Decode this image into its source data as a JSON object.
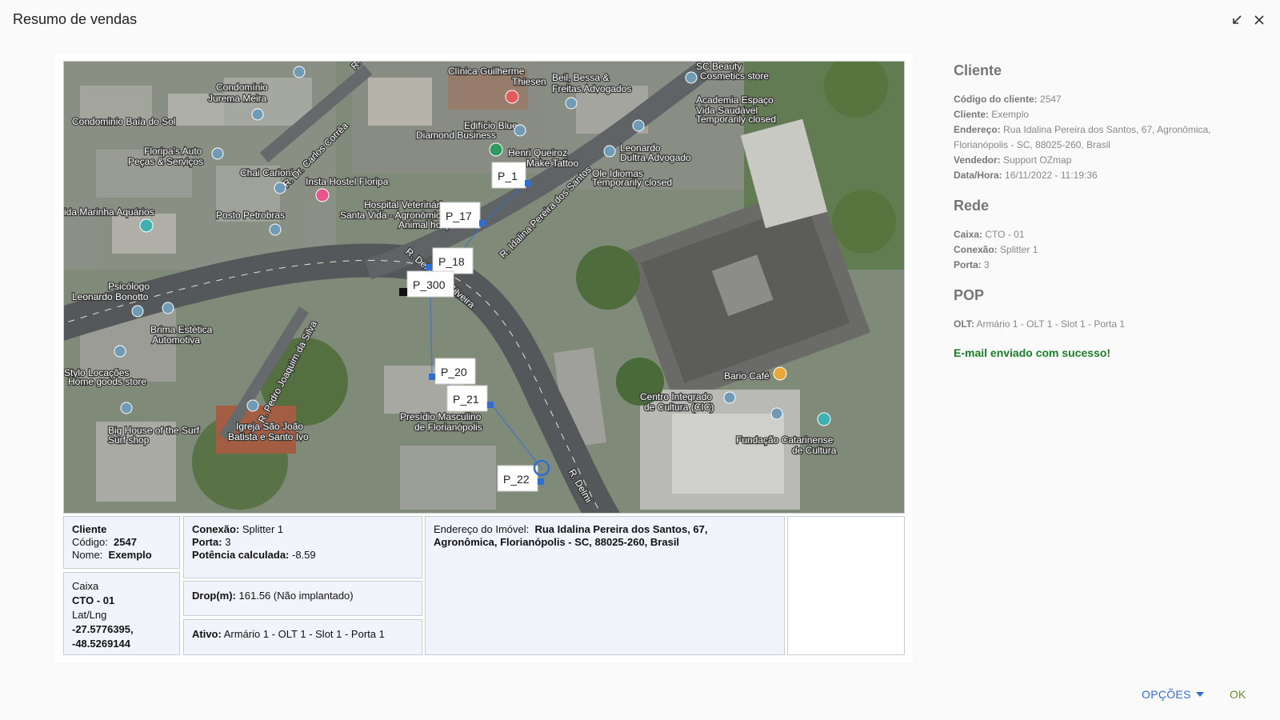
{
  "window": {
    "title": "Resumo de vendas"
  },
  "map": {
    "markers": [
      "P_1",
      "P_17",
      "P_18",
      "P_300",
      "P_20",
      "P_21",
      "P_22"
    ],
    "places": [
      "Condomínio Jurema Meira",
      "Condominio Baía do Sol",
      "Clínica Guilherme Thiesen",
      "Beil, Bessa & Freitas Advogados",
      "SC Beauty",
      "Cosmetics store",
      "Academia Espaço Vida Saudável",
      "Temporarily closed",
      "Edifício Blue Diamond Business",
      "Henri Queiroz Make Tattoo",
      "Leonardo Dultra Advogado",
      "Ole Idiomas",
      "Temporarily closed",
      "Floripa's Auto Peças & Serviços",
      "Chai Carioni",
      "Insta Hostel Floripa",
      "Hospital Veterinário Santa Vida - Agronômica",
      "Animal hosp",
      "ida Marinha Aquários",
      "Posto Petrobras",
      "Psicólogo Leonardo Bonotto",
      "Brima Estética Automotiva",
      "Stylo Locações",
      "Home goods store",
      "Big House of the Surf",
      "Surf shop",
      "Igreja São João Batista e Santo Ivo",
      "Presídio Masculino de Florianópolis",
      "Bario Café",
      "Centro Integrado de Cultura (CIC)",
      "Fundação Catarinense de Cultura"
    ],
    "streets": [
      "R. Dr. Carlos Corrêa",
      "R. Idalina Pereira dos Santos",
      "R. Delminda Silveira",
      "R. Pedro Joaquim da Silva",
      "R. Delmi",
      "R."
    ]
  },
  "grid": {
    "cliente": {
      "title": "Cliente",
      "codigo_label": "Código:",
      "codigo": "2547",
      "nome_label": "Nome:",
      "nome": "Exemplo"
    },
    "caixa": {
      "title": "Caixa",
      "value": "CTO - 01",
      "latlng_label": "Lat/Lng",
      "latlng_1": "-27.5776395,",
      "latlng_2": "-48.5269144"
    },
    "conexao": {
      "conexao_label": "Conexão:",
      "conexao": "Splitter 1",
      "porta_label": "Porta:",
      "porta": "3",
      "potencia_label": "Potência calculada:",
      "potencia": "-8.59"
    },
    "drop": {
      "label": "Drop(m):",
      "value": "161.56 (Não implantado)"
    },
    "ativo": {
      "label": "Ativo:",
      "value": "Armário 1 - OLT 1 - Slot 1 - Porta 1"
    },
    "endereco": {
      "label": "Endereço do Imóvel:",
      "value_1": "Rua Idalina Pereira dos Santos, 67,",
      "value_2": "Agronômica, Florianópolis - SC, 88025-260, Brasil"
    }
  },
  "side": {
    "cliente": {
      "title": "Cliente",
      "codigo_label": "Código do cliente:",
      "codigo": "2547",
      "cliente_label": "Cliente:",
      "cliente": "Exemplo",
      "endereco_label": "Endereço:",
      "endereco_1": "Rua Idalina Pereira dos Santos, 67, Agronômica,",
      "endereco_2": "Florianópolis - SC, 88025-260, Brasil",
      "vendedor_label": "Vendedor:",
      "vendedor": "Support OZmap",
      "data_label": "Data/Hora:",
      "data": "16/11/2022 - 11:19:36"
    },
    "rede": {
      "title": "Rede",
      "caixa_label": "Caixa:",
      "caixa": "CTO - 01",
      "conexao_label": "Conexão:",
      "conexao": "Splitter 1",
      "porta_label": "Porta:",
      "porta": "3"
    },
    "pop": {
      "title": "POP",
      "olt_label": "OLT:",
      "olt": "Armário 1 - OLT 1 - Slot 1 - Porta 1"
    },
    "success": "E-mail enviado com sucesso!"
  },
  "footer": {
    "options": "OPÇÕES",
    "ok": "OK"
  },
  "colors": {
    "accent": "#2f6fd4",
    "ok": "#6a8f24",
    "success": "#1b7f28",
    "marker": "#2f6fd4"
  }
}
